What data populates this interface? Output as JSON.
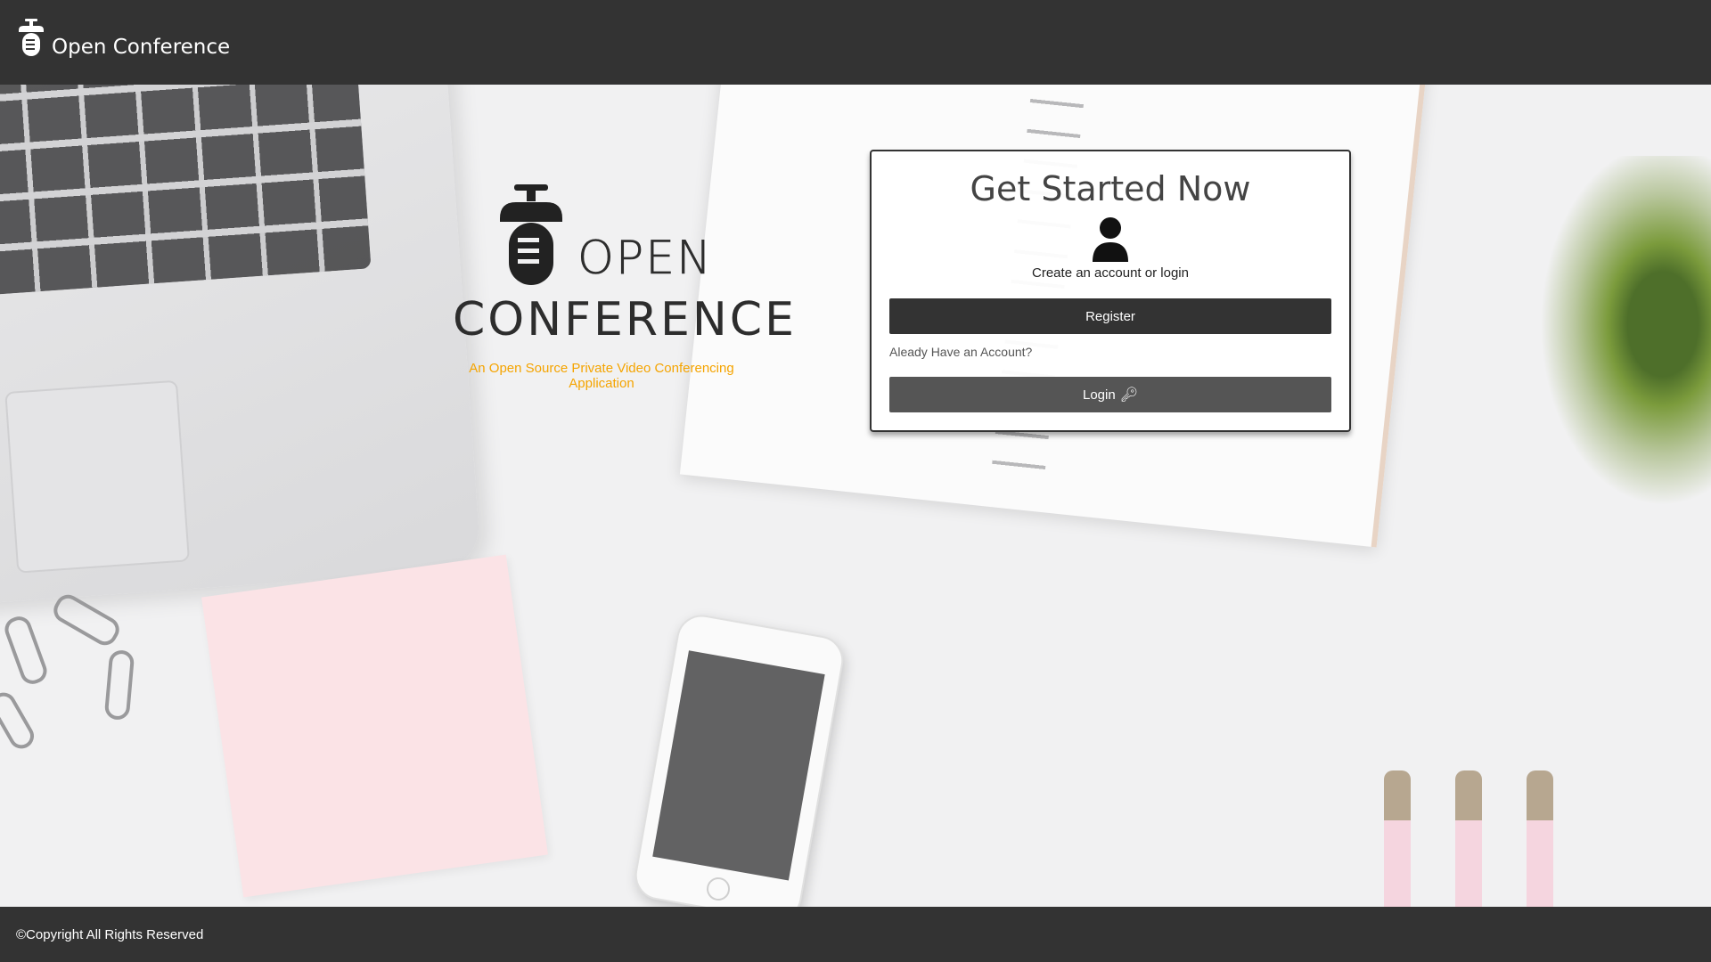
{
  "header": {
    "app_name": "Open Conference",
    "logo_icon": "microphone-logo-icon"
  },
  "hero": {
    "line1": "OPEN",
    "line2": "CONFERENCE",
    "tagline": "An Open Source Private Video Conferencing Application"
  },
  "card": {
    "title": "Get Started Now",
    "user_icon": "user-icon",
    "subtitle": "Create an account or login",
    "register_label": "Register",
    "question": "Aleady Have an Account?",
    "login_label": "Login",
    "login_icon": "key-icon"
  },
  "footer": {
    "copyright": "©Copyright All Rights Reserved"
  },
  "colors": {
    "bar": "#333333",
    "accent": "#f5a400",
    "login_button": "#555555"
  }
}
